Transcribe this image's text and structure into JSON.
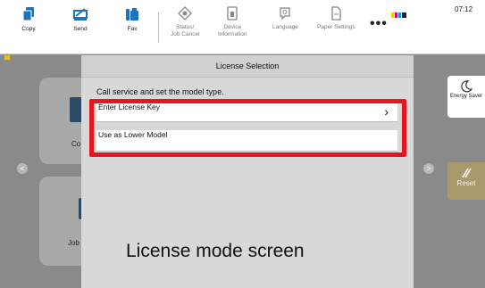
{
  "toolbar": {
    "items": [
      {
        "label": "Copy"
      },
      {
        "label": "Send"
      },
      {
        "label": "Fax"
      },
      {
        "label_line1": "Status/",
        "label_line2": "Job Cancel"
      },
      {
        "label_line1": "Device",
        "label_line2": "Information"
      },
      {
        "label": "Language"
      },
      {
        "label": "Paper Settings"
      }
    ],
    "more_label": "•••",
    "toner_colors": [
      "#f0d000",
      "#d0007a",
      "#00a0e0",
      "#222222"
    ],
    "time": "07:12",
    "accent_color": "#1e73be"
  },
  "background": {
    "tile1_label": "Co",
    "tile2_label": "Job",
    "energy_saver_label": "Energy Saver",
    "reset_label": "Reset",
    "nav_left": "<",
    "nav_right": ">"
  },
  "dialog": {
    "title": "License Selection",
    "message": "Call service and set the model type.",
    "options": [
      {
        "label": "Enter License Key",
        "chevron": "›"
      },
      {
        "label": "Use as Lower Model"
      }
    ]
  },
  "caption": "License mode screen",
  "highlight_color": "#e8141e"
}
